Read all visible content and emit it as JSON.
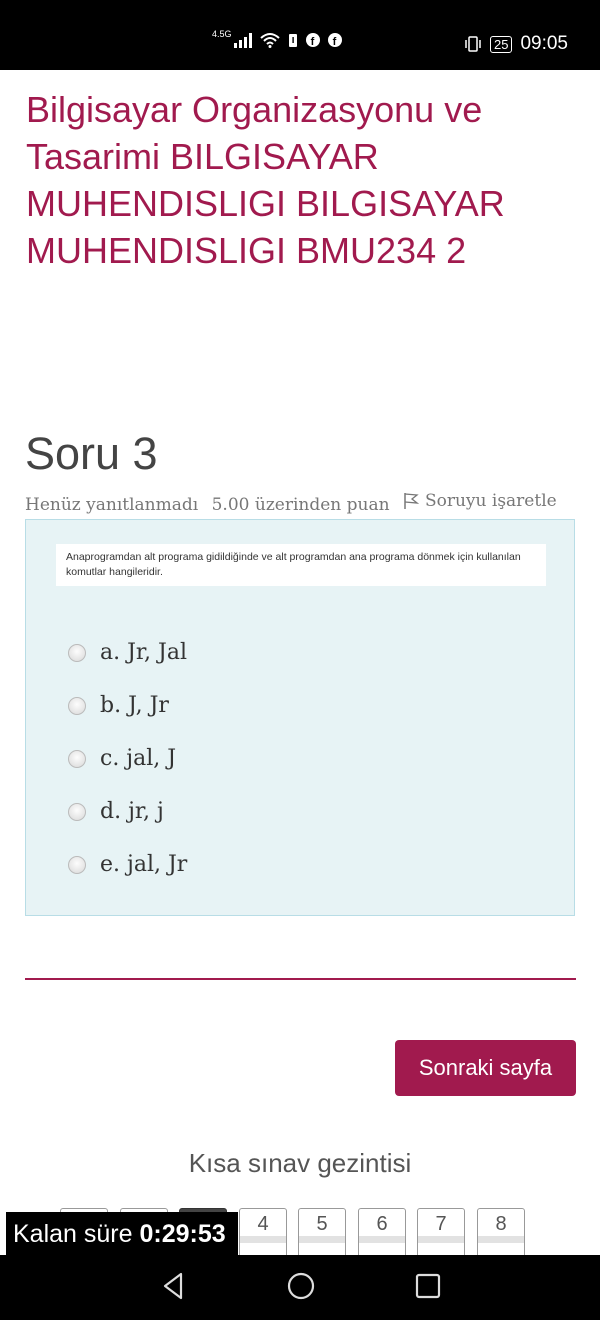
{
  "status_bar": {
    "network": "4.5G",
    "battery": "25",
    "time": "09:05"
  },
  "course_title": "Bilgisayar Organizasyonu ve Tasarimi BILGISAYAR MUHENDISLIGI BILGISAYAR MUHENDISLIGI BMU234 2",
  "question": {
    "heading": "Soru 3",
    "state": "Henüz yanıtlanmadı",
    "points": "5.00 üzerinden puan",
    "flag_label": "Soruyu işaretle",
    "text": "Anaprogramdan alt programa gidildiğinde ve alt programdan ana programa dönmek için kullanılan komutlar hangileridir.",
    "answers": [
      "a. Jr, Jal",
      "b. J, Jr",
      "c. jal, J",
      "d. jr, j",
      "e. jal, Jr"
    ]
  },
  "next_button": "Sonraki sayfa",
  "quiz_nav": {
    "title": "Kısa sınav gezintisi",
    "pages": [
      "4",
      "5",
      "6",
      "7",
      "8"
    ]
  },
  "timer": {
    "label": "Kalan süre",
    "value": "0:29:53"
  }
}
